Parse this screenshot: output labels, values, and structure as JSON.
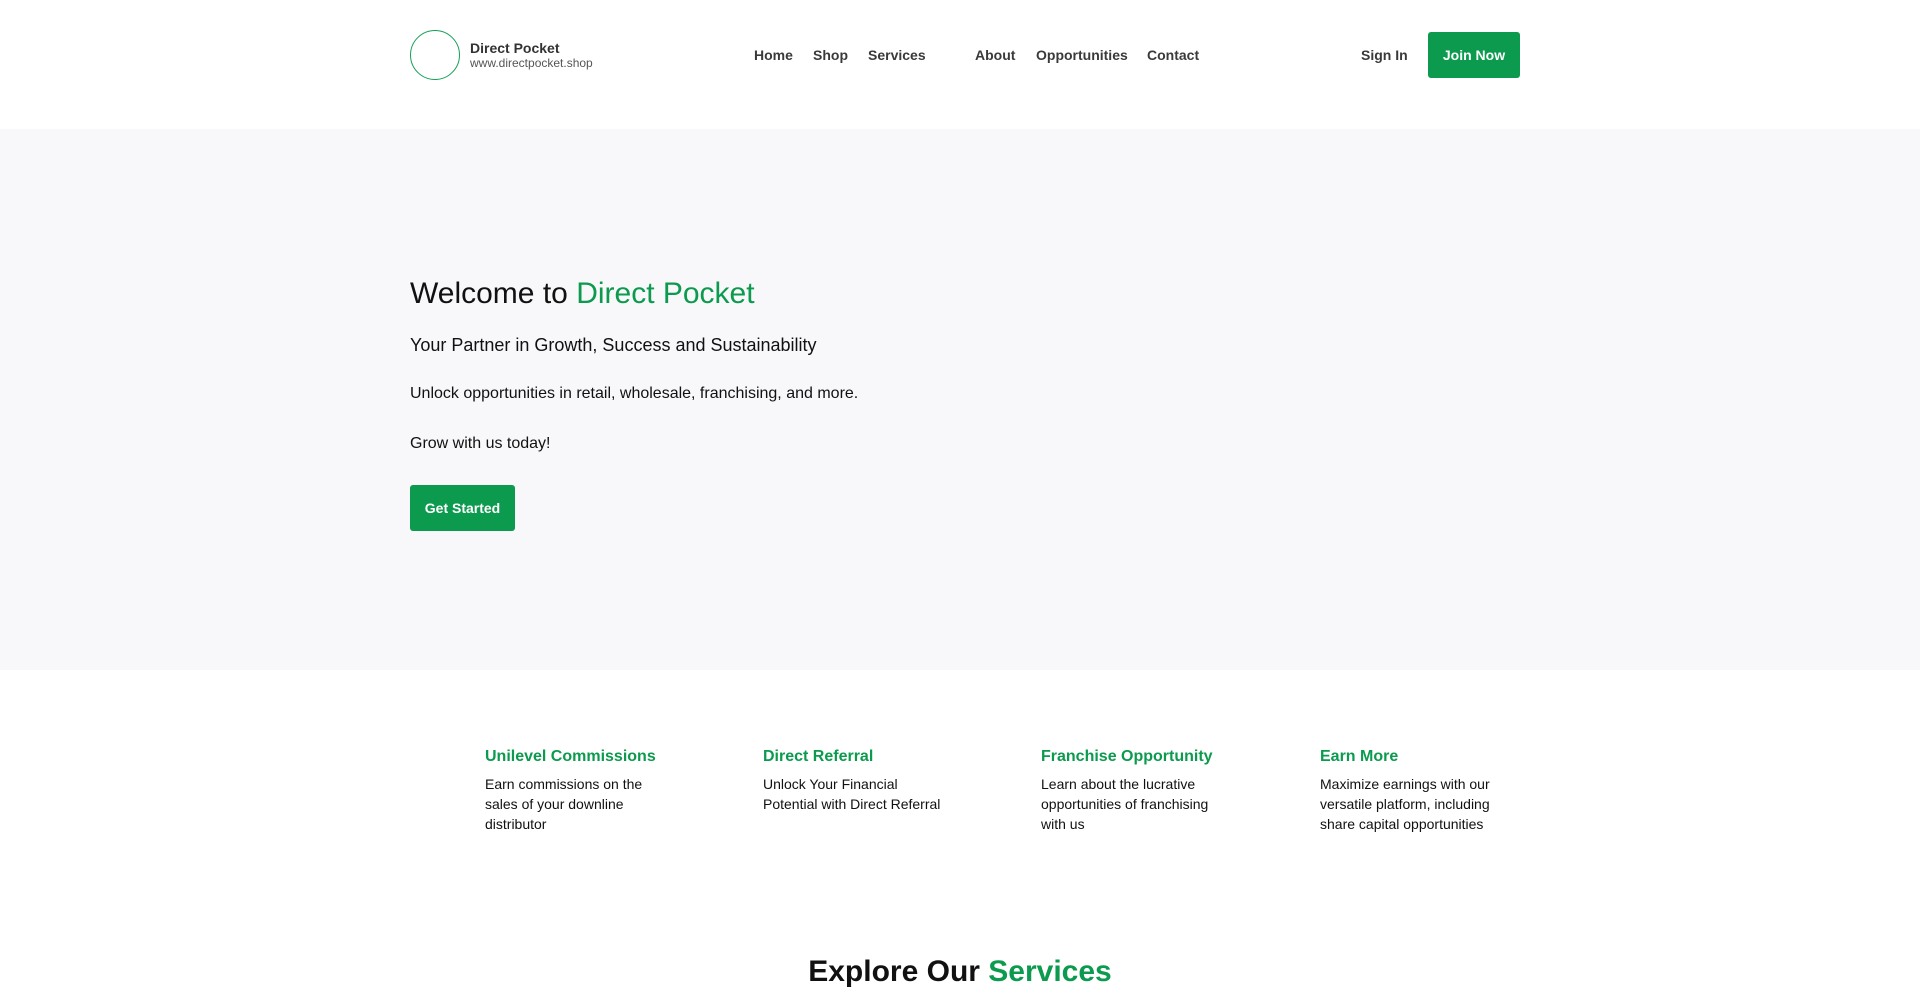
{
  "header": {
    "brand_name": "Direct Pocket",
    "brand_url": "www.directpocket.shop",
    "nav": [
      "Home",
      "Shop",
      "Services",
      "About",
      "Opportunities",
      "Contact"
    ],
    "sign_in": "Sign In",
    "join_now": "Join Now"
  },
  "hero": {
    "title_prefix": "Welcome to",
    "title_accent": "Direct Pocket",
    "subtitle": "Your Partner in Growth, Success and Sustainability",
    "line1": "Unlock opportunities in retail, wholesale, franchising, and more.",
    "line2": "Grow with us today!",
    "cta": "Get Started"
  },
  "features": [
    {
      "title": "Unilevel Commissions",
      "desc": "Earn commissions on the sales of your downline distributor"
    },
    {
      "title": "Direct Referral",
      "desc": "Unlock Your Financial Potential with Direct Referral"
    },
    {
      "title": "Franchise Opportunity",
      "desc": "Learn about the lucrative opportunities of franchising with us"
    },
    {
      "title": "Earn More",
      "desc": "Maximize earnings with our versatile platform, including share capital opportunities"
    }
  ],
  "explore": {
    "prefix": "Explore Our",
    "accent": "Services"
  },
  "colors": {
    "accent": "#0b9a4e",
    "hero_bg": "#f8f7fa",
    "text": "#111111"
  }
}
